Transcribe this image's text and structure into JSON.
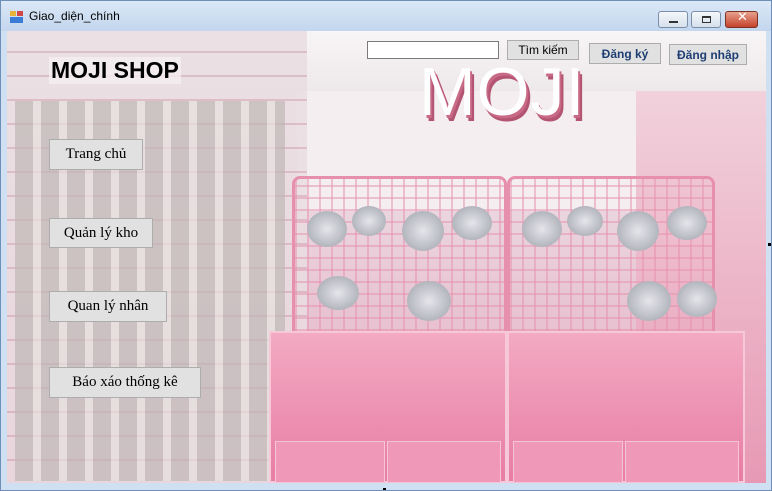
{
  "window": {
    "title": "Giao_diện_chính",
    "minimize_glyph": "",
    "maximize_glyph": "",
    "close_glyph": "✕"
  },
  "banner": {
    "logo_text": "MOJI",
    "shop_name": "MOJI SHOP"
  },
  "header": {
    "search_value": "",
    "search_button": "Tìm kiếm",
    "register_button": "Đăng ký",
    "login_button": "Đăng nhập"
  },
  "nav": {
    "items": [
      {
        "label": "Trang chủ"
      },
      {
        "label": "Quản lý kho"
      },
      {
        "label": "Quan lý nhân"
      },
      {
        "label": "Báo xáo thống kê"
      }
    ]
  },
  "colors": {
    "accent_pink": "#e77da3",
    "link_blue": "#1f3e73",
    "button_face": "#e1e1e1"
  }
}
